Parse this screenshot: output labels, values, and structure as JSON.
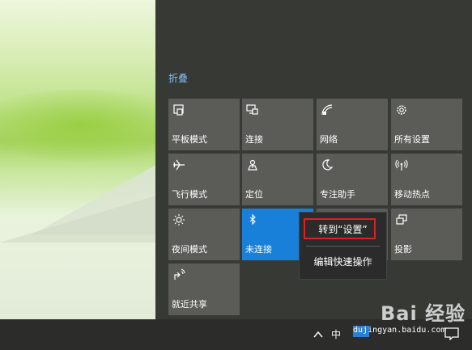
{
  "panel": {
    "collapse_label": "折叠"
  },
  "tiles": [
    {
      "label": "平板模式",
      "icon": "tablet-mode-icon"
    },
    {
      "label": "连接",
      "icon": "connect-icon"
    },
    {
      "label": "网络",
      "icon": "network-icon"
    },
    {
      "label": "所有设置",
      "icon": "gear-icon"
    },
    {
      "label": "飞行模式",
      "icon": "airplane-icon"
    },
    {
      "label": "定位",
      "icon": "location-icon"
    },
    {
      "label": "专注助手",
      "icon": "moon-icon"
    },
    {
      "label": "移动热点",
      "icon": "hotspot-icon"
    },
    {
      "label": "夜间模式",
      "icon": "brightness-icon"
    },
    {
      "label": "未连接",
      "icon": "bluetooth-icon"
    },
    {
      "label": "",
      "icon": ""
    },
    {
      "label": "投影",
      "icon": "project-icon"
    },
    {
      "label": "就近共享",
      "icon": "nearby-share-icon"
    }
  ],
  "context_menu": {
    "go_to_settings": "转到“设置”",
    "edit_quick_actions": "编辑快速操作"
  },
  "taskbar": {
    "ime_label": "中"
  },
  "watermark": {
    "site": "jingyan.baidu.com",
    "logo": "Bai 经验",
    "box": "du"
  },
  "colors": {
    "accent": "#1880d8",
    "highlight": "#e02020",
    "tile": "#5b5c57",
    "panel": "#373a34"
  }
}
